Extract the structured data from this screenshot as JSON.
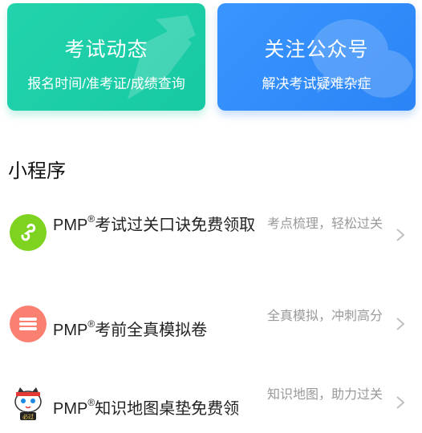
{
  "cards": [
    {
      "title": "考试动态",
      "subtitle": "报名时间/准考证/成绩查询",
      "color": "#1fcfa8"
    },
    {
      "title": "关注公众号",
      "subtitle": "解决考试疑难杂症",
      "color": "#3390fb"
    }
  ],
  "section": {
    "title": "小程序"
  },
  "mini_programs": [
    {
      "name_prefix": "PMP",
      "registered": "®",
      "name": "考试过关口诀免费领取",
      "desc": "考点梳理，轻松过关",
      "icon": "mini-program-link-icon",
      "icon_color": "#7ed321"
    },
    {
      "name_prefix": "PMP",
      "registered": "®",
      "name": "考前全真模拟卷",
      "desc": "全真模拟，冲刺高分",
      "icon": "exam-paper-icon",
      "icon_color": "#fa8072"
    },
    {
      "name_prefix": "PMP",
      "registered": "®",
      "name": "知识地图桌垫免费领",
      "desc": "知识地图，助力过关",
      "icon": "cat-mascot-icon",
      "icon_color": "#e53935",
      "badge": "必过"
    }
  ]
}
